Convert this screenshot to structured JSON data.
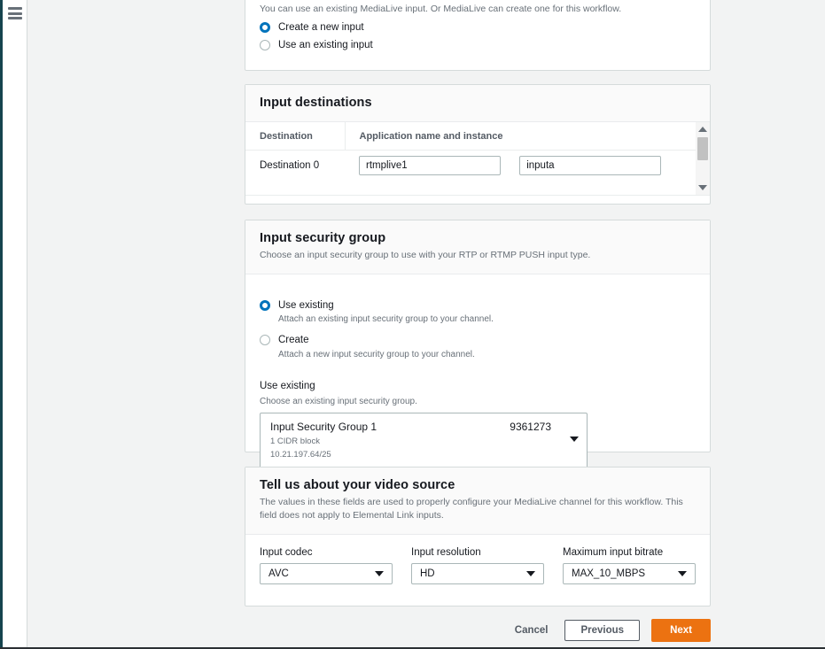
{
  "nav": {
    "hamburger_label": "Open navigation"
  },
  "input_panel": {
    "description": "You can use an existing MediaLive input. Or MediaLive can create one for this workflow.",
    "options": [
      {
        "label": "Create a new input",
        "selected": true
      },
      {
        "label": "Use an existing input",
        "selected": false
      }
    ]
  },
  "input_destinations": {
    "title": "Input destinations",
    "columns": [
      "Destination",
      "Application name and instance"
    ],
    "rows": [
      {
        "destination": "Destination 0",
        "application_name": "rtmplive1",
        "instance": "inputa"
      }
    ],
    "scrollbar": {
      "up_icon": "triangle-up-icon",
      "down_icon": "triangle-down-icon"
    }
  },
  "input_security_group": {
    "title": "Input security group",
    "description": "Choose an input security group to use with your RTP or RTMP PUSH input type.",
    "options": [
      {
        "label": "Use existing",
        "sub": "Attach an existing input security group to your channel.",
        "selected": true
      },
      {
        "label": "Create",
        "sub": "Attach a new input security group to your channel.",
        "selected": false
      }
    ],
    "field": {
      "label": "Use existing",
      "description": "Choose an existing input security group.",
      "selected": {
        "name": "Input Security Group 1",
        "id": "9361273",
        "cidr_count": "1 CIDR block",
        "cidr": "10.21.197.64/25"
      }
    }
  },
  "video_source": {
    "title": "Tell us about your video source",
    "description": "The values in these fields are used to properly configure your MediaLive channel for this workflow. This field does not apply to Elemental Link inputs.",
    "fields": [
      {
        "label": "Input codec",
        "value": "AVC"
      },
      {
        "label": "Input resolution",
        "value": "HD"
      },
      {
        "label": "Maximum input bitrate",
        "value": "MAX_10_MBPS"
      }
    ]
  },
  "footer": {
    "cancel_label": "Cancel",
    "previous_label": "Previous",
    "next_label": "Next"
  },
  "colors": {
    "accent_blue": "#0073bb",
    "primary_orange": "#ec7211",
    "rail_dark": "#16444e",
    "page_bg": "#f2f3f3"
  }
}
